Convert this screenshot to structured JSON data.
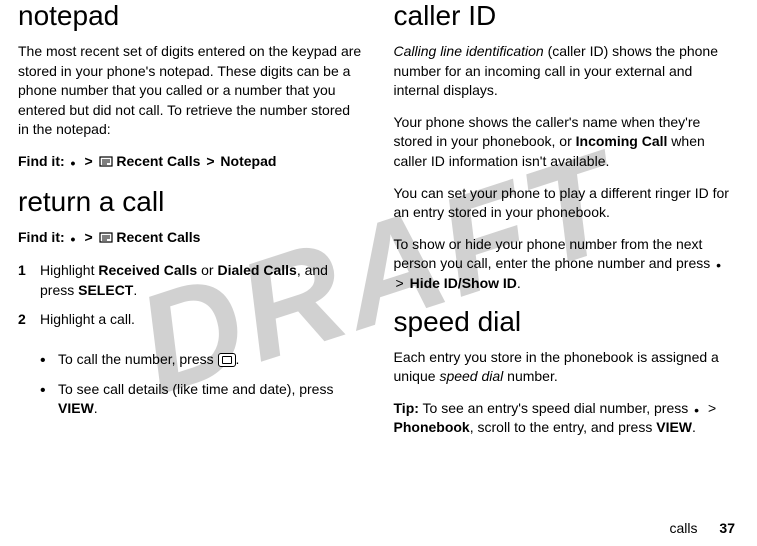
{
  "watermark": "DRAFT",
  "left": {
    "notepad": {
      "heading": "notepad",
      "para": "The most recent set of digits entered on the keypad are stored in your phone's notepad. These digits can be a phone number that you called or a number that you entered but did not call. To retrieve the number stored in the notepad:",
      "findit_label": "Find it:",
      "gt1": ">",
      "recent": "Recent Calls",
      "gt2": ">",
      "notepad_item": "Notepad"
    },
    "return": {
      "heading": "return a call",
      "findit_label": "Find it:",
      "gt1": ">",
      "recent": "Recent Calls",
      "step1_a": "Highlight ",
      "step1_received": "Received Calls",
      "step1_or": " or ",
      "step1_dialed": "Dialed Calls",
      "step1_b": ", and press ",
      "step1_select": "SELECT",
      "step1_c": ".",
      "step2": "Highlight a call.",
      "bullet1_a": "To call the number, press ",
      "bullet1_b": ".",
      "bullet2_a": "To see call details (like time and date), press ",
      "bullet2_view": "VIEW",
      "bullet2_b": "."
    }
  },
  "right": {
    "callerid": {
      "heading": "caller ID",
      "para1_term": "Calling line identification",
      "para1_rest": " (caller ID) shows the phone number for an incoming call in your external and internal displays.",
      "para2_a": "Your phone shows the caller's name when they're stored in your phonebook, or ",
      "para2_incoming": "Incoming Call",
      "para2_b": " when caller ID information isn't available.",
      "para3": "You can set your phone to play a different ringer ID for an entry stored in your phonebook.",
      "para4_a": "To show or hide your phone number from the next person you call, enter the phone number and press ",
      "para4_gt": ">",
      "para4_hide": "Hide ID/Show ID",
      "para4_b": "."
    },
    "speed": {
      "heading": "speed dial",
      "para1_a": "Each entry you store in the phonebook is assigned a unique ",
      "para1_term": "speed dial",
      "para1_b": " number.",
      "tip_label": "Tip:",
      "tip_a": " To see an entry's speed dial number, press ",
      "tip_gt": ">",
      "tip_phonebook": "Phonebook",
      "tip_b": ", scroll to the entry, and press ",
      "tip_view": "VIEW",
      "tip_c": "."
    }
  },
  "footer": {
    "section": "calls",
    "page": "37"
  }
}
